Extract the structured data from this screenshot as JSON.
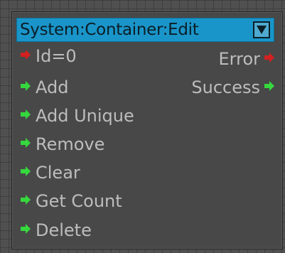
{
  "node": {
    "title": "System:Container:Edit",
    "inputs": [
      {
        "label": "Id=0",
        "arrow_icon": "red-arrow-icon",
        "color": "#d42020"
      },
      {
        "label": "Add",
        "arrow_icon": "green-arrow-icon",
        "color": "#35d83d"
      },
      {
        "label": "Add Unique",
        "arrow_icon": "green-arrow-icon",
        "color": "#35d83d"
      },
      {
        "label": "Remove",
        "arrow_icon": "green-arrow-icon",
        "color": "#35d83d"
      },
      {
        "label": "Clear",
        "arrow_icon": "green-arrow-icon",
        "color": "#35d83d"
      },
      {
        "label": "Get Count",
        "arrow_icon": "green-arrow-icon",
        "color": "#35d83d"
      },
      {
        "label": "Delete",
        "arrow_icon": "green-arrow-icon",
        "color": "#35d83d"
      }
    ],
    "outputs": [
      {
        "label": "Error",
        "arrow_icon": "red-arrow-icon",
        "color": "#d42020"
      },
      {
        "label": "Success",
        "arrow_icon": "green-arrow-icon",
        "color": "#35d83d"
      }
    ]
  },
  "colors": {
    "title_bar": "#1a95c9",
    "node_body": "#484848",
    "canvas": "#505050",
    "label_text": "#bdbdbd"
  }
}
